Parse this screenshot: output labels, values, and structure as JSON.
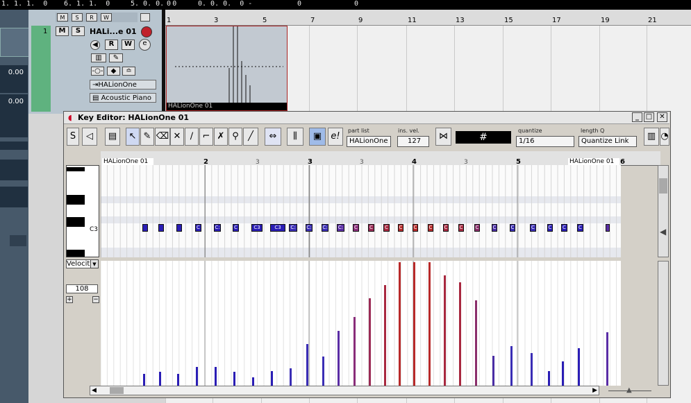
{
  "transport": {
    "pos1": "1. 1. 1.  0",
    "pos2": "6. 1. 1.  0",
    "pos3": "5. 0. 0.  0",
    "pos4": "0",
    "pos5": "0. 0. 0.  0 -",
    "pos6": "0",
    "pos7": "0"
  },
  "left_panel": {
    "value1": "0.00",
    "value2": "0.00"
  },
  "track": {
    "number": "1",
    "mute": "M",
    "solo": "S",
    "name": "HALi...e 01",
    "read": "R",
    "write": "W",
    "instrument": "HALionOne",
    "program": "Acoustic Piano"
  },
  "arrange_ruler": [
    "1",
    "3",
    "5",
    "7",
    "9",
    "11",
    "13",
    "15",
    "17",
    "19",
    "21"
  ],
  "part_label": "HALionOne 01",
  "key_editor": {
    "title": "Key Editor: HALionOne 01",
    "part_list_label": "part list",
    "part_list_value": "HALionOne",
    "ins_vel_label": "ins. vel.",
    "ins_vel_value": "127",
    "quantize_label": "quantize",
    "quantize_value": "1/16",
    "length_q_label": "length Q",
    "length_q_value": "Quantize Link",
    "ruler_major": [
      "2",
      "3",
      "4",
      "5",
      "6"
    ],
    "ruler_minor": [
      "3",
      "3",
      "3",
      "3"
    ],
    "part_start": "HALionOne 01",
    "part_end": "HALionOne 01",
    "key_label": "C3",
    "controller": "Velocity",
    "controller_value": "108",
    "notes": [
      {
        "label": "",
        "color": "#2a1db5"
      },
      {
        "label": "",
        "color": "#2a1db5"
      },
      {
        "label": "",
        "color": "#2a1db5"
      },
      {
        "label": "C",
        "color": "#2a1db5"
      },
      {
        "label": "C:",
        "color": "#2a1db5"
      },
      {
        "label": "C",
        "color": "#2a1db5"
      },
      {
        "label": "C3",
        "color": "#2a1db5"
      },
      {
        "label": "C3",
        "color": "#2a1db5"
      },
      {
        "label": "C:",
        "color": "#3a2db5"
      },
      {
        "label": "C:",
        "color": "#3a2db5"
      },
      {
        "label": "C:",
        "color": "#3a2db5"
      },
      {
        "label": "C:",
        "color": "#5a2da5"
      },
      {
        "label": "C",
        "color": "#8a2d7a"
      },
      {
        "label": "C",
        "color": "#9a2a55"
      },
      {
        "label": "C",
        "color": "#a8283f"
      },
      {
        "label": "C",
        "color": "#b82a2a"
      },
      {
        "label": "C",
        "color": "#b82a2a"
      },
      {
        "label": "C",
        "color": "#b82a2a"
      },
      {
        "label": "C",
        "color": "#a8283f"
      },
      {
        "label": "C",
        "color": "#a8283f"
      },
      {
        "label": "C",
        "color": "#8a2d6a"
      },
      {
        "label": "C",
        "color": "#4a2da5"
      },
      {
        "label": "C",
        "color": "#3a2db5"
      },
      {
        "label": "C",
        "color": "#3a2db5"
      },
      {
        "label": "C",
        "color": "#2a1db5"
      },
      {
        "label": "C",
        "color": "#2a1db5"
      },
      {
        "label": "C",
        "color": "#2a1db5"
      },
      {
        "label": "",
        "color": "#5a2da5"
      }
    ],
    "velocities": [
      17,
      20,
      17,
      27,
      27,
      20,
      12,
      21,
      25,
      60,
      42,
      79,
      99,
      126,
      145,
      178,
      178,
      178,
      159,
      149,
      123,
      43,
      57,
      47,
      21,
      35,
      54,
      77
    ]
  },
  "colors": {
    "low_velocity": "#2a1db5",
    "high_velocity": "#b82a2a"
  }
}
